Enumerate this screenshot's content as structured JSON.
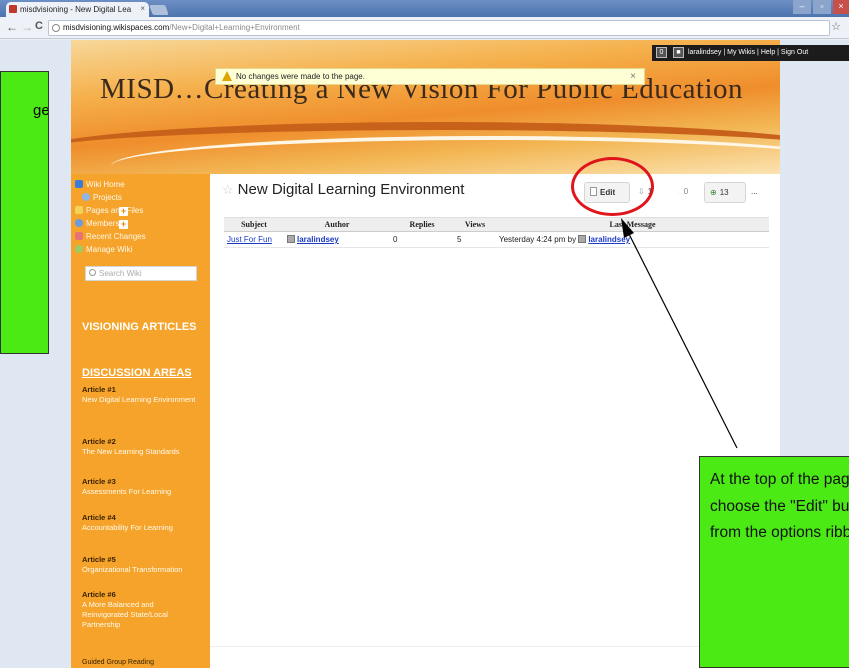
{
  "browser": {
    "tab_title": "misdvisioning - New Digital Lea",
    "tab_close": "×",
    "url_host": "misdvisioning.wikispaces.com",
    "url_path": "/New+Digital+Learning+Environment",
    "back": "←",
    "forward": "→",
    "reload": "C",
    "bookmark": "☆"
  },
  "userbar": {
    "count1": "0",
    "links": "laralindsey | My Wikis | Help | Sign Out"
  },
  "notice": {
    "text": "No changes were made to the page.",
    "close": "×"
  },
  "banner": {
    "title": "MISD…Creating a New Vision For Public Education"
  },
  "sidebar": {
    "items": [
      {
        "label": "Wiki Home"
      },
      {
        "label": "Projects"
      },
      {
        "label": "Pages and Files"
      },
      {
        "label": "Members"
      },
      {
        "label": "Recent Changes"
      },
      {
        "label": "Manage Wiki"
      }
    ],
    "search_placeholder": "Search Wiki",
    "visioning": "VISIONING ARTICLES",
    "discussion": "DISCUSSION AREAS",
    "articles": [
      {
        "num": "Article #1",
        "title": "New Digital Learning Environment"
      },
      {
        "num": "Article #2",
        "title": "The New Learning Standards"
      },
      {
        "num": "Article #3",
        "title": "Assessments For Learning"
      },
      {
        "num": "Article #4",
        "title": "Accountability For Learning"
      },
      {
        "num": "Article #5",
        "title": "Organizational Transformation"
      },
      {
        "num": "Article #6",
        "title": "A More Balanced and Reinvigorated State/Local Partnership"
      }
    ],
    "tail": "Guided Group Reading"
  },
  "main": {
    "title": "New Digital Learning Environment",
    "actions": {
      "edit": "Edit",
      "a2": "1",
      "a3": "0",
      "a4": "13",
      "more": "..."
    },
    "table": {
      "headers": [
        "Subject",
        "Author",
        "Replies",
        "Views",
        "Last Message"
      ],
      "rows": [
        {
          "subject": "Just For Fun",
          "author": "laralindsey",
          "replies": "0",
          "views": "5",
          "last_prefix": "Yesterday 4:24 pm by",
          "last_user": "laralindsey"
        }
      ]
    }
  },
  "annotations": {
    "left_text": "ge",
    "right_text": "At the top of the page choose the \"Edit\" button from the options ribbon."
  },
  "colors": {
    "accent_orange": "#f5a32a",
    "callout_green": "#4bea14",
    "circle_red": "#e0151b"
  }
}
